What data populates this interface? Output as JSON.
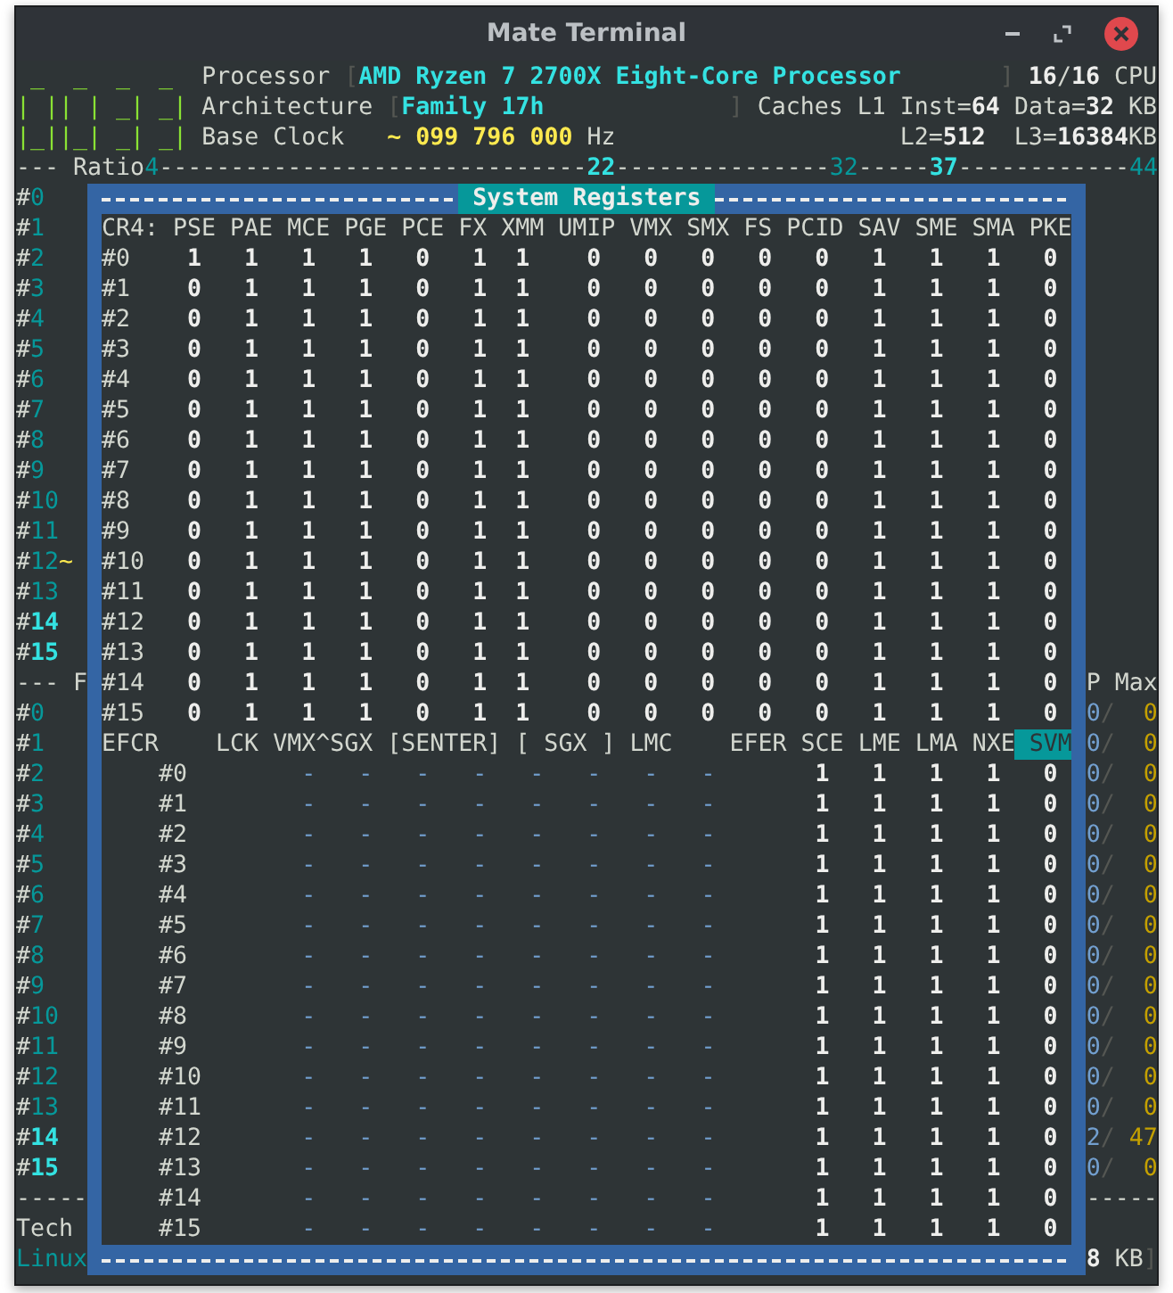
{
  "window": {
    "title": "Mate Terminal"
  },
  "header": {
    "logo": [
      " _  _  _  _ ",
      "| || | _| _|",
      "|_||_| _| _|"
    ],
    "processor": {
      "label": "Processor",
      "open": "[",
      "value": "AMD Ryzen 7 2700X Eight-Core Processor",
      "close": "]",
      "cpus_online": "16",
      "separator": "/",
      "cpus_total": "16",
      "unit": "CPU"
    },
    "architecture": {
      "label": "Architecture",
      "open": "[",
      "value": "Family 17h",
      "close": "]",
      "caches_label": "Caches L1 Inst=",
      "l1_inst": "64",
      "data_label": "Data=",
      "l1_data": "32",
      "unit": "KB"
    },
    "base_clock": {
      "label": "Base Clock",
      "value": "~ 099 796 000",
      "unit": "Hz",
      "l2_label": "L2=",
      "l2": "512",
      "l3_label": "L3=",
      "l3": "16384",
      "l3_unit": "KB"
    }
  },
  "ratio": [
    {
      "text": "--- Ratio",
      "kind": "plain"
    },
    {
      "text": "4",
      "kind": "mark"
    },
    {
      "text": "------------------------------",
      "kind": "plain"
    },
    {
      "text": "22",
      "kind": "peak"
    },
    {
      "text": "---------------",
      "kind": "plain"
    },
    {
      "text": "32",
      "kind": "mark"
    },
    {
      "text": "-----",
      "kind": "plain"
    },
    {
      "text": "37",
      "kind": "peak"
    },
    {
      "text": "------------",
      "kind": "plain"
    },
    {
      "text": "44",
      "kind": "mark"
    }
  ],
  "cores_left": [
    {
      "kind": "core",
      "prefix": "#",
      "number": "0",
      "emphasis": false
    },
    {
      "kind": "core",
      "prefix": "#",
      "number": "1",
      "emphasis": false
    },
    {
      "kind": "core",
      "prefix": "#",
      "number": "2",
      "emphasis": false
    },
    {
      "kind": "core",
      "prefix": "#",
      "number": "3",
      "emphasis": false
    },
    {
      "kind": "core",
      "prefix": "#",
      "number": "4",
      "emphasis": false
    },
    {
      "kind": "core",
      "prefix": "#",
      "number": "5",
      "emphasis": false
    },
    {
      "kind": "core",
      "prefix": "#",
      "number": "6",
      "emphasis": false
    },
    {
      "kind": "core",
      "prefix": "#",
      "number": "7",
      "emphasis": false
    },
    {
      "kind": "core",
      "prefix": "#",
      "number": "8",
      "emphasis": false
    },
    {
      "kind": "core",
      "prefix": "#",
      "number": "9",
      "emphasis": false
    },
    {
      "kind": "core",
      "prefix": "#",
      "number": "10",
      "emphasis": false
    },
    {
      "kind": "core",
      "prefix": "#",
      "number": "11",
      "emphasis": false
    },
    {
      "kind": "core",
      "prefix": "#",
      "number": "12",
      "suffix": "~",
      "emphasis": false
    },
    {
      "kind": "core",
      "prefix": "#",
      "number": "13",
      "emphasis": false
    },
    {
      "kind": "core",
      "prefix": "#",
      "number": "14",
      "emphasis": true
    },
    {
      "kind": "core",
      "prefix": "#",
      "number": "15",
      "emphasis": true
    },
    {
      "kind": "text",
      "text": "--- F"
    },
    {
      "kind": "core",
      "prefix": "#",
      "number": "0",
      "emphasis": false
    },
    {
      "kind": "core",
      "prefix": "#",
      "number": "1",
      "emphasis": false
    },
    {
      "kind": "core",
      "prefix": "#",
      "number": "2",
      "emphasis": false
    },
    {
      "kind": "core",
      "prefix": "#",
      "number": "3",
      "emphasis": false
    },
    {
      "kind": "core",
      "prefix": "#",
      "number": "4",
      "emphasis": false
    },
    {
      "kind": "core",
      "prefix": "#",
      "number": "5",
      "emphasis": false
    },
    {
      "kind": "core",
      "prefix": "#",
      "number": "6",
      "emphasis": false
    },
    {
      "kind": "core",
      "prefix": "#",
      "number": "7",
      "emphasis": false
    },
    {
      "kind": "core",
      "prefix": "#",
      "number": "8",
      "emphasis": false
    },
    {
      "kind": "core",
      "prefix": "#",
      "number": "9",
      "emphasis": false
    },
    {
      "kind": "core",
      "prefix": "#",
      "number": "10",
      "emphasis": false
    },
    {
      "kind": "core",
      "prefix": "#",
      "number": "11",
      "emphasis": false
    },
    {
      "kind": "core",
      "prefix": "#",
      "number": "12",
      "emphasis": false
    },
    {
      "kind": "core",
      "prefix": "#",
      "number": "13",
      "emphasis": false
    },
    {
      "kind": "core",
      "prefix": "#",
      "number": "14",
      "emphasis": true
    },
    {
      "kind": "core",
      "prefix": "#",
      "number": "15",
      "emphasis": true
    },
    {
      "kind": "text",
      "text": "-----"
    },
    {
      "kind": "text",
      "text": "Tech"
    },
    {
      "kind": "accent",
      "text": "Linux"
    }
  ],
  "dialog": {
    "title": "System Registers",
    "cr4": {
      "label": "CR4:",
      "columns": [
        "PSE",
        "PAE",
        "MCE",
        "PGE",
        "PCE",
        "FX",
        "XMM",
        "UMIP",
        "VMX",
        "SMX",
        "FS",
        "PCID",
        "SAV",
        "SME",
        "SMA",
        "PKE"
      ],
      "rows": [
        {
          "label": "#0",
          "values": [
            "1",
            "1",
            "1",
            "1",
            "0",
            "1",
            "1",
            "0",
            "0",
            "0",
            "0",
            "0",
            "1",
            "1",
            "1",
            "0"
          ]
        },
        {
          "label": "#1",
          "values": [
            "0",
            "1",
            "1",
            "1",
            "0",
            "1",
            "1",
            "0",
            "0",
            "0",
            "0",
            "0",
            "1",
            "1",
            "1",
            "0"
          ]
        },
        {
          "label": "#2",
          "values": [
            "0",
            "1",
            "1",
            "1",
            "0",
            "1",
            "1",
            "0",
            "0",
            "0",
            "0",
            "0",
            "1",
            "1",
            "1",
            "0"
          ]
        },
        {
          "label": "#3",
          "values": [
            "0",
            "1",
            "1",
            "1",
            "0",
            "1",
            "1",
            "0",
            "0",
            "0",
            "0",
            "0",
            "1",
            "1",
            "1",
            "0"
          ]
        },
        {
          "label": "#4",
          "values": [
            "0",
            "1",
            "1",
            "1",
            "0",
            "1",
            "1",
            "0",
            "0",
            "0",
            "0",
            "0",
            "1",
            "1",
            "1",
            "0"
          ]
        },
        {
          "label": "#5",
          "values": [
            "0",
            "1",
            "1",
            "1",
            "0",
            "1",
            "1",
            "0",
            "0",
            "0",
            "0",
            "0",
            "1",
            "1",
            "1",
            "0"
          ]
        },
        {
          "label": "#6",
          "values": [
            "0",
            "1",
            "1",
            "1",
            "0",
            "1",
            "1",
            "0",
            "0",
            "0",
            "0",
            "0",
            "1",
            "1",
            "1",
            "0"
          ]
        },
        {
          "label": "#7",
          "values": [
            "0",
            "1",
            "1",
            "1",
            "0",
            "1",
            "1",
            "0",
            "0",
            "0",
            "0",
            "0",
            "1",
            "1",
            "1",
            "0"
          ]
        },
        {
          "label": "#8",
          "values": [
            "0",
            "1",
            "1",
            "1",
            "0",
            "1",
            "1",
            "0",
            "0",
            "0",
            "0",
            "0",
            "1",
            "1",
            "1",
            "0"
          ]
        },
        {
          "label": "#9",
          "values": [
            "0",
            "1",
            "1",
            "1",
            "0",
            "1",
            "1",
            "0",
            "0",
            "0",
            "0",
            "0",
            "1",
            "1",
            "1",
            "0"
          ]
        },
        {
          "label": "#10",
          "values": [
            "0",
            "1",
            "1",
            "1",
            "0",
            "1",
            "1",
            "0",
            "0",
            "0",
            "0",
            "0",
            "1",
            "1",
            "1",
            "0"
          ]
        },
        {
          "label": "#11",
          "values": [
            "0",
            "1",
            "1",
            "1",
            "0",
            "1",
            "1",
            "0",
            "0",
            "0",
            "0",
            "0",
            "1",
            "1",
            "1",
            "0"
          ]
        },
        {
          "label": "#12",
          "values": [
            "0",
            "1",
            "1",
            "1",
            "0",
            "1",
            "1",
            "0",
            "0",
            "0",
            "0",
            "0",
            "1",
            "1",
            "1",
            "0"
          ]
        },
        {
          "label": "#13",
          "values": [
            "0",
            "1",
            "1",
            "1",
            "0",
            "1",
            "1",
            "0",
            "0",
            "0",
            "0",
            "0",
            "1",
            "1",
            "1",
            "0"
          ]
        },
        {
          "label": "#14",
          "values": [
            "0",
            "1",
            "1",
            "1",
            "0",
            "1",
            "1",
            "0",
            "0",
            "0",
            "0",
            "0",
            "1",
            "1",
            "1",
            "0"
          ]
        },
        {
          "label": "#15",
          "values": [
            "0",
            "1",
            "1",
            "1",
            "0",
            "1",
            "1",
            "0",
            "0",
            "0",
            "0",
            "0",
            "1",
            "1",
            "1",
            "0"
          ]
        }
      ]
    },
    "efcr": {
      "label": "EFCR",
      "columns": [
        "LCK",
        "VMX^SGX",
        "[SENTER]",
        "[ SGX ]",
        "LMC"
      ],
      "efer_label": "EFER",
      "efer_columns": [
        {
          "name": "SCE",
          "selected": false
        },
        {
          "name": "LME",
          "selected": false
        },
        {
          "name": "LMA",
          "selected": false
        },
        {
          "name": "NXE",
          "selected": false
        },
        {
          "name": "SVM",
          "selected": true
        }
      ],
      "rows": [
        {
          "label": "#0",
          "flags": [
            "-",
            "-",
            "-",
            "-",
            "-",
            "-",
            "-",
            "-"
          ],
          "efer": [
            "1",
            "1",
            "1",
            "1",
            "0"
          ]
        },
        {
          "label": "#1",
          "flags": [
            "-",
            "-",
            "-",
            "-",
            "-",
            "-",
            "-",
            "-"
          ],
          "efer": [
            "1",
            "1",
            "1",
            "1",
            "0"
          ]
        },
        {
          "label": "#2",
          "flags": [
            "-",
            "-",
            "-",
            "-",
            "-",
            "-",
            "-",
            "-"
          ],
          "efer": [
            "1",
            "1",
            "1",
            "1",
            "0"
          ]
        },
        {
          "label": "#3",
          "flags": [
            "-",
            "-",
            "-",
            "-",
            "-",
            "-",
            "-",
            "-"
          ],
          "efer": [
            "1",
            "1",
            "1",
            "1",
            "0"
          ]
        },
        {
          "label": "#4",
          "flags": [
            "-",
            "-",
            "-",
            "-",
            "-",
            "-",
            "-",
            "-"
          ],
          "efer": [
            "1",
            "1",
            "1",
            "1",
            "0"
          ]
        },
        {
          "label": "#5",
          "flags": [
            "-",
            "-",
            "-",
            "-",
            "-",
            "-",
            "-",
            "-"
          ],
          "efer": [
            "1",
            "1",
            "1",
            "1",
            "0"
          ]
        },
        {
          "label": "#6",
          "flags": [
            "-",
            "-",
            "-",
            "-",
            "-",
            "-",
            "-",
            "-"
          ],
          "efer": [
            "1",
            "1",
            "1",
            "1",
            "0"
          ]
        },
        {
          "label": "#7",
          "flags": [
            "-",
            "-",
            "-",
            "-",
            "-",
            "-",
            "-",
            "-"
          ],
          "efer": [
            "1",
            "1",
            "1",
            "1",
            "0"
          ]
        },
        {
          "label": "#8",
          "flags": [
            "-",
            "-",
            "-",
            "-",
            "-",
            "-",
            "-",
            "-"
          ],
          "efer": [
            "1",
            "1",
            "1",
            "1",
            "0"
          ]
        },
        {
          "label": "#9",
          "flags": [
            "-",
            "-",
            "-",
            "-",
            "-",
            "-",
            "-",
            "-"
          ],
          "efer": [
            "1",
            "1",
            "1",
            "1",
            "0"
          ]
        },
        {
          "label": "#10",
          "flags": [
            "-",
            "-",
            "-",
            "-",
            "-",
            "-",
            "-",
            "-"
          ],
          "efer": [
            "1",
            "1",
            "1",
            "1",
            "0"
          ]
        },
        {
          "label": "#11",
          "flags": [
            "-",
            "-",
            "-",
            "-",
            "-",
            "-",
            "-",
            "-"
          ],
          "efer": [
            "1",
            "1",
            "1",
            "1",
            "0"
          ]
        },
        {
          "label": "#12",
          "flags": [
            "-",
            "-",
            "-",
            "-",
            "-",
            "-",
            "-",
            "-"
          ],
          "efer": [
            "1",
            "1",
            "1",
            "1",
            "0"
          ]
        },
        {
          "label": "#13",
          "flags": [
            "-",
            "-",
            "-",
            "-",
            "-",
            "-",
            "-",
            "-"
          ],
          "efer": [
            "1",
            "1",
            "1",
            "1",
            "0"
          ]
        },
        {
          "label": "#14",
          "flags": [
            "-",
            "-",
            "-",
            "-",
            "-",
            "-",
            "-",
            "-"
          ],
          "efer": [
            "1",
            "1",
            "1",
            "1",
            "0"
          ]
        },
        {
          "label": "#15",
          "flags": [
            "-",
            "-",
            "-",
            "-",
            "-",
            "-",
            "-",
            "-"
          ],
          "efer": [
            "1",
            "1",
            "1",
            "1",
            "0"
          ]
        }
      ]
    }
  },
  "cores_right": [
    {
      "kind": "heading",
      "text": "P Max"
    },
    {
      "kind": "count",
      "index": "0",
      "separator": "/",
      "value": "0"
    },
    {
      "kind": "count",
      "index": "0",
      "separator": "/",
      "value": "0"
    },
    {
      "kind": "count",
      "index": "0",
      "separator": "/",
      "value": "0"
    },
    {
      "kind": "count",
      "index": "0",
      "separator": "/",
      "value": "0"
    },
    {
      "kind": "count",
      "index": "0",
      "separator": "/",
      "value": "0"
    },
    {
      "kind": "count",
      "index": "0",
      "separator": "/",
      "value": "0"
    },
    {
      "kind": "count",
      "index": "0",
      "separator": "/",
      "value": "0"
    },
    {
      "kind": "count",
      "index": "0",
      "separator": "/",
      "value": "0"
    },
    {
      "kind": "count",
      "index": "0",
      "separator": "/",
      "value": "0"
    },
    {
      "kind": "count",
      "index": "0",
      "separator": "/",
      "value": "0"
    },
    {
      "kind": "count",
      "index": "0",
      "separator": "/",
      "value": "0"
    },
    {
      "kind": "count",
      "index": "0",
      "separator": "/",
      "value": "0"
    },
    {
      "kind": "count",
      "index": "0",
      "separator": "/",
      "value": "0"
    },
    {
      "kind": "count",
      "index": "0",
      "separator": "/",
      "value": "0"
    },
    {
      "kind": "count",
      "index": "2",
      "separator": "/",
      "value": "47"
    },
    {
      "kind": "count",
      "index": "0",
      "separator": "/",
      "value": "0"
    },
    {
      "kind": "text",
      "text": "-----"
    },
    {
      "kind": "footer",
      "value": "8",
      "unit": "KB",
      "close": "]"
    }
  ]
}
